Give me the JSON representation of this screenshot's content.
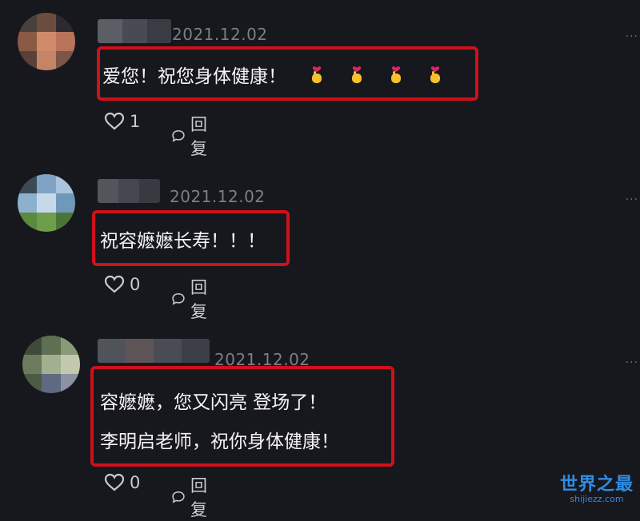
{
  "comments": [
    {
      "date": "2021.12.02",
      "text_lines": [
        "爱您！祝您身体健康！"
      ],
      "emoji_count": 4,
      "likes": "1",
      "reply_label": "回复",
      "more": "···"
    },
    {
      "date": "2021.12.02",
      "text_lines": [
        "祝容嬷嬷长寿！！！"
      ],
      "likes": "0",
      "reply_label": "回复",
      "more": "···"
    },
    {
      "date": "2021.12.02",
      "text_lines": [
        "容嬷嬷，您又闪亮 登场了！",
        "李明启老师，祝你身体健康！"
      ],
      "likes": "0",
      "reply_label": "回复",
      "more": "···"
    }
  ],
  "watermark": {
    "title": "世界之最",
    "url": "shijiezz.com"
  },
  "colors": {
    "background": "#17181d",
    "highlight_border": "#d0101a",
    "date": "#7c7e88",
    "watermark": "#2f8de4"
  },
  "icons": [
    "heart-outline-icon",
    "speech-bubble-icon",
    "more-dots-icon",
    "fingers-heart-emoji"
  ]
}
